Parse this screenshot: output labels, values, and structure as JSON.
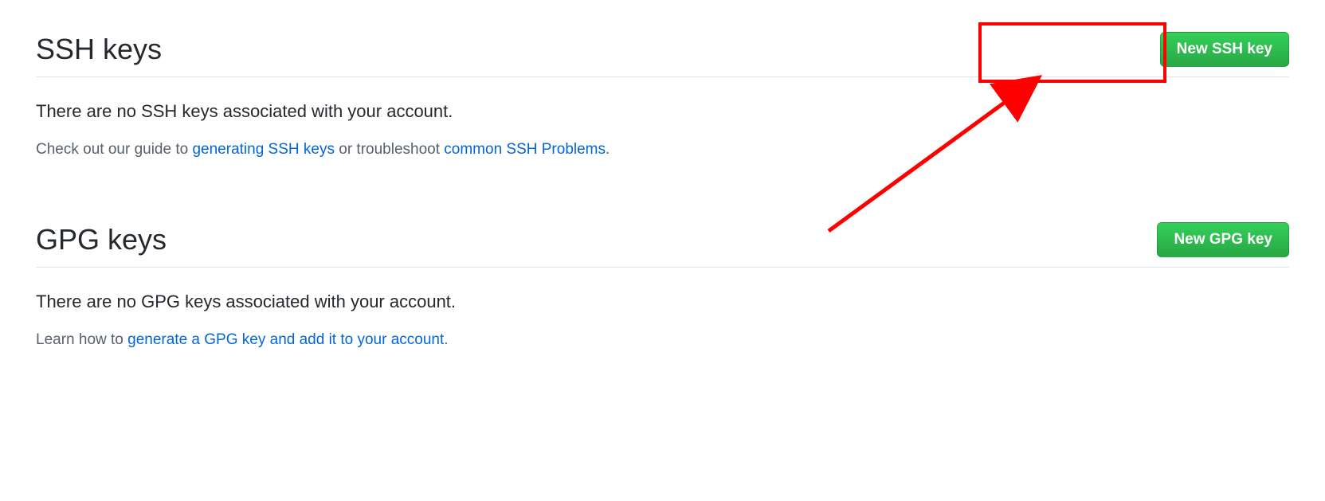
{
  "ssh": {
    "title": "SSH keys",
    "button_label": "New SSH key",
    "empty_message": "There are no SSH keys associated with your account.",
    "help_prefix": "Check out our guide to ",
    "help_link1": "generating SSH keys",
    "help_middle": " or troubleshoot ",
    "help_link2": "common SSH Problems",
    "help_suffix": "."
  },
  "gpg": {
    "title": "GPG keys",
    "button_label": "New GPG key",
    "empty_message": "There are no GPG keys associated with your account.",
    "help_prefix": "Learn how to ",
    "help_link1": "generate a GPG key and add it to your account",
    "help_suffix": "."
  }
}
